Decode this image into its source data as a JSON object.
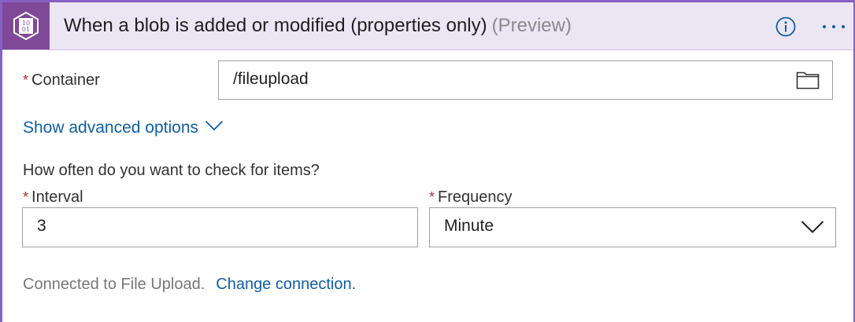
{
  "trigger": {
    "title": "When a blob is added or modified (properties only)",
    "badge": "(Preview)",
    "app_icon": "blob-storage-icon",
    "accent_color": "#804998",
    "header_bg": "#ece5f4",
    "info_icon": "info-icon",
    "more_icon": "more-options-icon"
  },
  "container": {
    "required_mark": "*",
    "label": "Container",
    "value": "/fileupload",
    "picker_icon": "folder-icon"
  },
  "advanced": {
    "label": "Show advanced options",
    "icon": "chevron-down-icon",
    "link_color": "#0f5ea6"
  },
  "recurrence": {
    "question": "How often do you want to check for items?",
    "interval": {
      "required_mark": "*",
      "label": "Interval",
      "value": "3"
    },
    "frequency": {
      "required_mark": "*",
      "label": "Frequency",
      "value": "Minute",
      "icon": "chevron-down-icon"
    }
  },
  "connection": {
    "status": "Connected to File Upload.",
    "change_link": "Change connection."
  },
  "required_color": "#c4262e"
}
